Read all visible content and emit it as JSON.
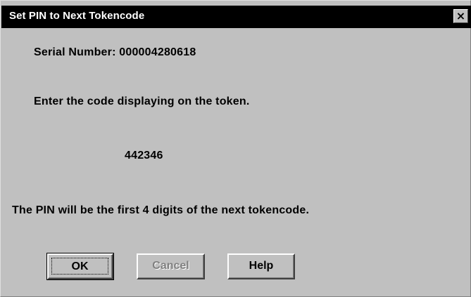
{
  "window": {
    "title": "Set PIN to Next Tokencode",
    "close_glyph": "×"
  },
  "content": {
    "serial_number": "Serial Number: 000004280618",
    "instruction": "Enter the code displaying on the token.",
    "tokencode": "442346",
    "pin_note": "The PIN will be the first 4 digits of the next tokencode."
  },
  "buttons": {
    "ok_label": "OK",
    "cancel_label": "Cancel",
    "cancel_enabled": false,
    "help_label": "Help"
  },
  "colors": {
    "dialog_face": "#c0c0c0",
    "titlebar": "#000000",
    "title_text": "#ffffff",
    "disabled_text": "#808080"
  }
}
